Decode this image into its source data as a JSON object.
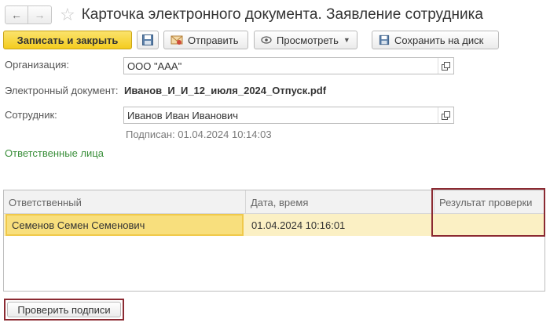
{
  "window": {
    "title": "Карточка электронного документа. Заявление сотрудника"
  },
  "toolbar": {
    "save_close_label": "Записать и закрыть",
    "send_label": "Отправить",
    "view_label": "Просмотреть",
    "save_disk_label": "Сохранить на диск"
  },
  "form": {
    "org_label": "Организация:",
    "org_value": "ООО \"ААА\"",
    "doc_label": "Электронный документ:",
    "doc_value": "Иванов_И_И_12_июля_2024_Отпуск.pdf",
    "employee_label": "Сотрудник:",
    "employee_value": "Иванов Иван Иванович",
    "signed_text": "Подписан: 01.04.2024 10:14:03",
    "responsible_link": "Ответственные лица"
  },
  "table": {
    "columns": [
      "Ответственный",
      "Дата, время",
      "Результат проверки"
    ],
    "rows": [
      [
        "Семенов Семен Семенович",
        "01.04.2024 10:16:01",
        ""
      ]
    ]
  },
  "bottom": {
    "verify_label": "Проверить подписи"
  },
  "colors": {
    "primary_button": "#f4cc1e",
    "highlight_border": "#8b2a32",
    "link_green": "#3a8f3a",
    "row_highlight": "#fbf0c4"
  }
}
